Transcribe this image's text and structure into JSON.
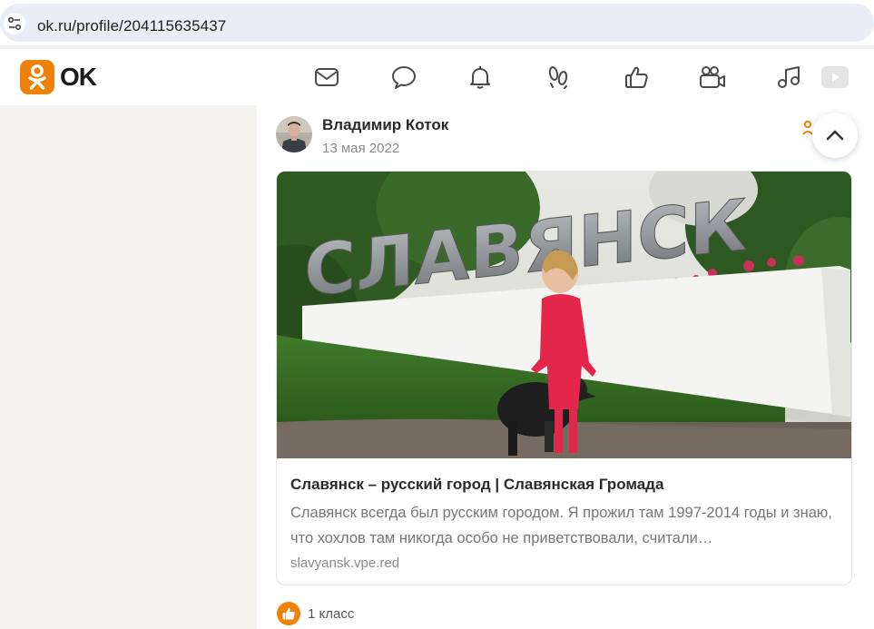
{
  "browser": {
    "url": "ok.ru/profile/204115635437"
  },
  "header": {
    "logo_text": "OK",
    "nav_icons": [
      "mail-icon",
      "chat-icon",
      "bell-icon",
      "guests-icon",
      "thumbs-up-icon",
      "video-camera-icon",
      "music-icon",
      "video-icon"
    ]
  },
  "post": {
    "author": "Владимир Коток",
    "date": "13 мая 2022",
    "link": {
      "title": "Славянск – русский город | Славянская Громада",
      "description": "Славянск всегда был русским городом. Я прожил там 1997-2014 годы и знаю, что хохлов там никогда особо не приветствовали, считали…",
      "domain": "slavyansk.vpe.red",
      "image_sign_text": "СЛАВЯНСК"
    },
    "likes": "1 класс"
  },
  "colors": {
    "brand": "#ee8208",
    "addressbar": "#e9eef6",
    "page_bg": "#f5f3f0"
  }
}
